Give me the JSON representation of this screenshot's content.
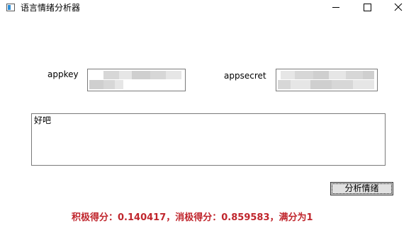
{
  "window": {
    "title": "语言情绪分析器"
  },
  "form": {
    "appkey_label": "appkey",
    "appkey_value": "",
    "appsecret_label": "appsecret",
    "appsecret_value": "",
    "input_text": "好吧",
    "analyze_label": "分析情绪"
  },
  "result": {
    "text": "积极得分：0.140417，消极得分：0.859583，满分为1",
    "color": "#c0262d"
  },
  "icons": {
    "app": "window-app-icon",
    "minimize": "minimize-icon",
    "maximize": "maximize-icon",
    "close": "close-icon"
  }
}
